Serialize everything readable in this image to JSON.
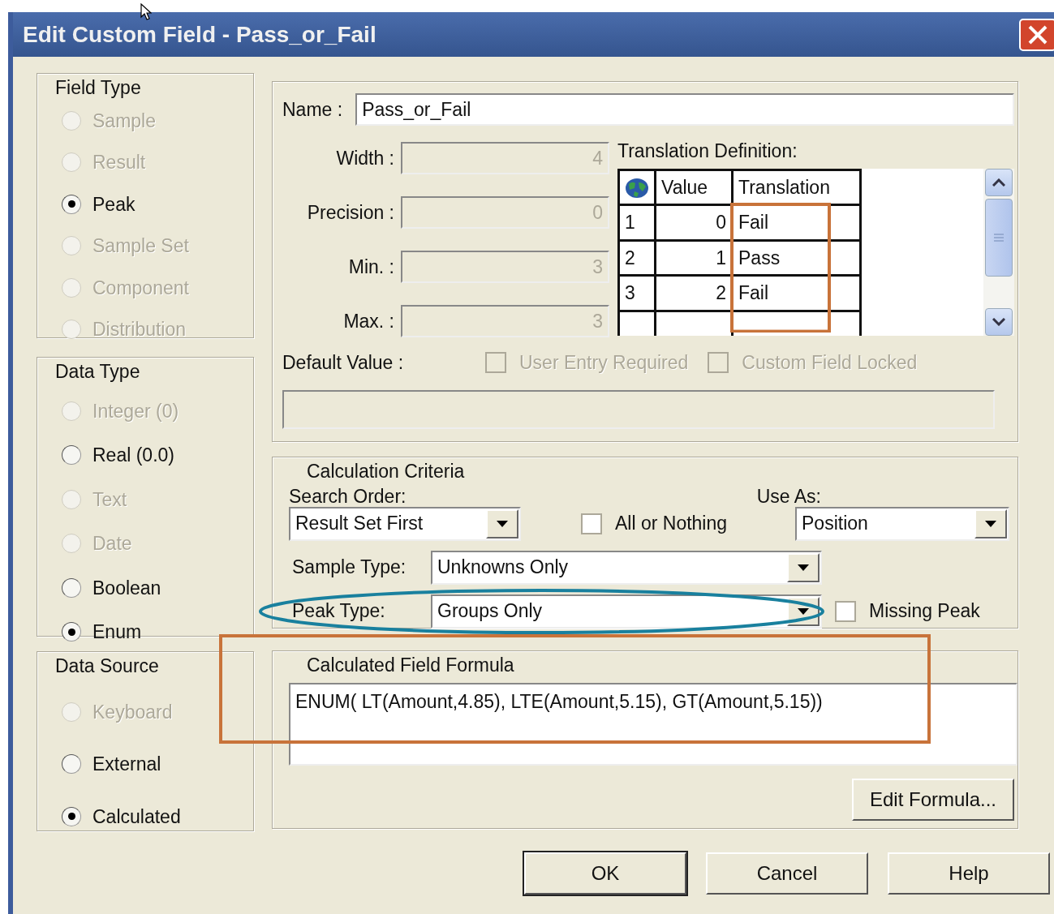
{
  "window": {
    "title": "Edit Custom Field - Pass_or_Fail"
  },
  "field_type": {
    "title": "Field Type",
    "options": [
      {
        "label": "Sample",
        "selected": false,
        "disabled": true
      },
      {
        "label": "Result",
        "selected": false,
        "disabled": true
      },
      {
        "label": "Peak",
        "selected": true,
        "disabled": false
      },
      {
        "label": "Sample Set",
        "selected": false,
        "disabled": true
      },
      {
        "label": "Component",
        "selected": false,
        "disabled": true
      },
      {
        "label": "Distribution",
        "selected": false,
        "disabled": true
      }
    ]
  },
  "data_type": {
    "title": "Data Type",
    "options": [
      {
        "label": "Integer (0)",
        "selected": false,
        "disabled": true
      },
      {
        "label": "Real (0.0)",
        "selected": false,
        "disabled": false
      },
      {
        "label": "Text",
        "selected": false,
        "disabled": true
      },
      {
        "label": "Date",
        "selected": false,
        "disabled": true
      },
      {
        "label": "Boolean",
        "selected": false,
        "disabled": false
      },
      {
        "label": "Enum",
        "selected": true,
        "disabled": false
      }
    ]
  },
  "data_source": {
    "title": "Data Source",
    "options": [
      {
        "label": "Keyboard",
        "selected": false,
        "disabled": true
      },
      {
        "label": "External",
        "selected": false,
        "disabled": false
      },
      {
        "label": "Calculated",
        "selected": true,
        "disabled": false
      }
    ]
  },
  "name": {
    "label": "Name :",
    "value": "Pass_or_Fail"
  },
  "numeric_fields": [
    {
      "label": "Width :",
      "value": "4",
      "disabled": true
    },
    {
      "label": "Precision :",
      "value": "0",
      "disabled": true
    },
    {
      "label": "Min. :",
      "value": "3",
      "disabled": true
    },
    {
      "label": "Max. :",
      "value": "3",
      "disabled": true
    }
  ],
  "translation_definition": {
    "label": "Translation Definition:",
    "columns": [
      "Value",
      "Translation"
    ],
    "rows": [
      {
        "row_number": "1",
        "value": "0",
        "translation": "Fail"
      },
      {
        "row_number": "2",
        "value": "1",
        "translation": "Pass"
      },
      {
        "row_number": "3",
        "value": "2",
        "translation": "Fail"
      }
    ]
  },
  "default_value": {
    "label": "Default Value :",
    "disabled": true
  },
  "options": [
    {
      "label": "User Entry Required",
      "checked": false,
      "disabled": true
    },
    {
      "label": "Custom Field Locked",
      "checked": false,
      "disabled": true
    }
  ],
  "calculation_criteria": {
    "title": "Calculation Criteria",
    "search_order": {
      "label": "Search Order:",
      "value": "Result Set First"
    },
    "all_or_nothing": {
      "label": "All or Nothing",
      "checked": false
    },
    "use_as": {
      "label": "Use As:",
      "value": "Position"
    },
    "sample_type": {
      "label": "Sample Type:",
      "value": "Unknowns Only"
    },
    "peak_type": {
      "label": "Peak Type:",
      "value": "Groups Only"
    },
    "missing_peak": {
      "label": "Missing Peak",
      "checked": false
    }
  },
  "formula": {
    "title": "Calculated Field Formula",
    "value": "ENUM( LT(Amount,4.85), LTE(Amount,5.15), GT(Amount,5.15))",
    "button": "Edit Formula..."
  },
  "buttons": [
    {
      "label": "OK",
      "default": true
    },
    {
      "label": "Cancel",
      "default": false
    },
    {
      "label": "Help",
      "default": false
    }
  ],
  "annotations": [
    {
      "kind": "rect",
      "color": "#c8733a"
    },
    {
      "kind": "ellipse",
      "color": "#19809e"
    },
    {
      "kind": "rect",
      "color": "#c8733a"
    }
  ]
}
